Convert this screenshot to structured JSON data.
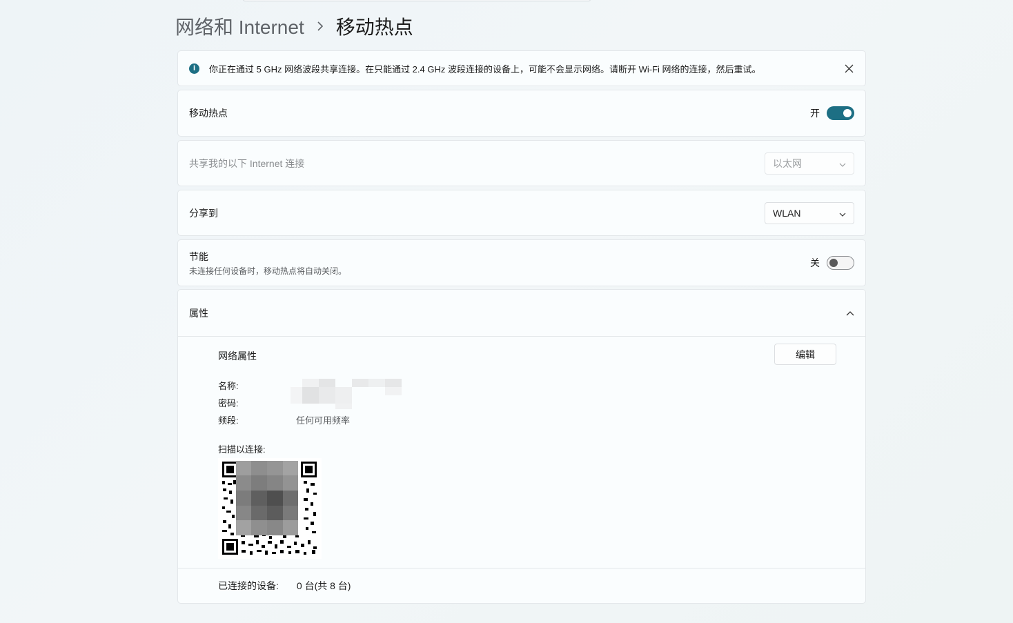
{
  "breadcrumb": {
    "parent": "网络和 Internet",
    "separator": "›",
    "current": "移动热点"
  },
  "info_bar": {
    "message": "你正在通过 5 GHz 网络波段共享连接。在只能通过 2.4 GHz 波段连接的设备上，可能不会显示网络。请断开 Wi-Fi 网络的连接，然后重试。",
    "icon": "info-icon",
    "close_icon": "close-icon"
  },
  "hotspot": {
    "title": "移动热点",
    "state_label": "开",
    "on": true
  },
  "share_from": {
    "title": "共享我的以下 Internet 连接",
    "selected": "以太网",
    "disabled": true
  },
  "share_to": {
    "title": "分享到",
    "selected": "WLAN"
  },
  "power_saving": {
    "title": "节能",
    "description": "未连接任何设备时，移动热点将自动关闭。",
    "state_label": "关",
    "on": false
  },
  "properties": {
    "title": "属性",
    "network_properties_label": "网络属性",
    "edit_button": "编辑",
    "name_label": "名称:",
    "password_label": "密码:",
    "band_label": "频段:",
    "band_value": "任何可用频率",
    "scan_label": "扫描以连接:",
    "connected_label": "已连接的设备:",
    "connected_value": "0 台(共 8 台)"
  },
  "colors": {
    "accent": "#1d6f84",
    "background": "#eef4f7",
    "card": "#fbfdfe"
  }
}
